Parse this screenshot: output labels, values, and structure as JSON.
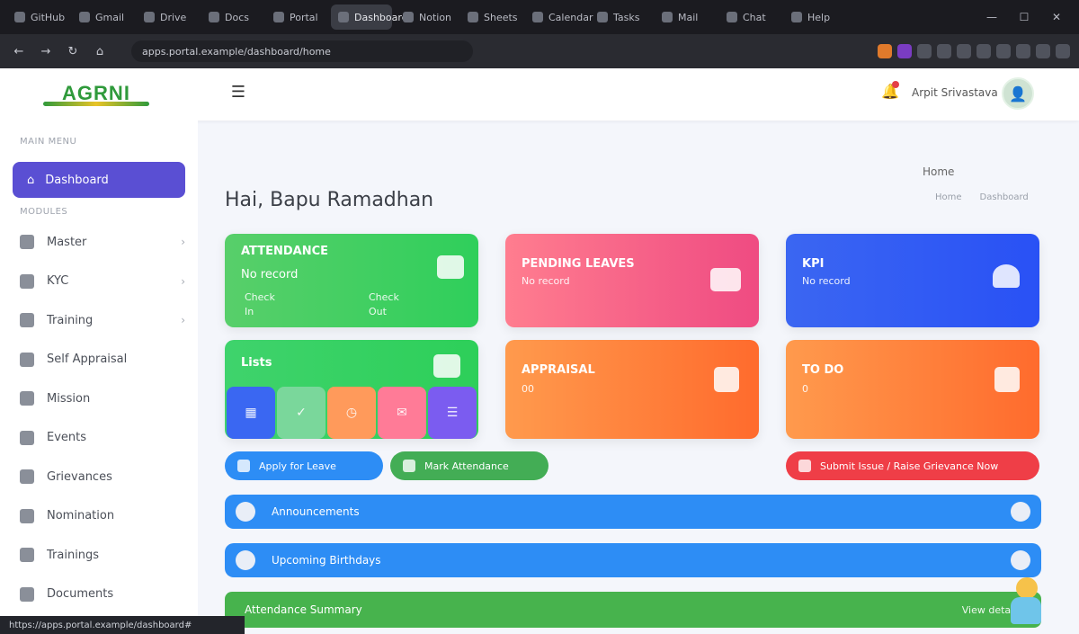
{
  "browser": {
    "tabs": [
      {
        "label": "GitHub",
        "active": false
      },
      {
        "label": "Gmail",
        "active": false
      },
      {
        "label": "Drive",
        "active": false
      },
      {
        "label": "Docs",
        "active": false
      },
      {
        "label": "Portal",
        "active": false
      },
      {
        "label": "Dashboard",
        "active": true
      },
      {
        "label": "Notion",
        "active": false
      },
      {
        "label": "Sheets",
        "active": false
      },
      {
        "label": "Calendar",
        "active": false
      },
      {
        "label": "Tasks",
        "active": false
      },
      {
        "label": "Mail",
        "active": false
      },
      {
        "label": "Chat",
        "active": false
      },
      {
        "label": "Help",
        "active": false
      }
    ],
    "address": "apps.portal.example/dashboard/home",
    "window_controls": {
      "minimize": "—",
      "maximize": "☐",
      "close": "✕"
    }
  },
  "header": {
    "logo_text": "AGRNI",
    "menu_icon": "☰",
    "user_name": "Arpit Srivastava",
    "avatar_icon": "👤",
    "bell_icon": "🔔"
  },
  "sidebar": {
    "section_main": "MAIN MENU",
    "active_item": "Dashboard",
    "section_modules": "MODULES",
    "items": [
      {
        "label": "Master",
        "chevron": "›"
      },
      {
        "label": "KYC",
        "chevron": "›"
      },
      {
        "label": "Training",
        "chevron": "›"
      },
      {
        "label": "Self Appraisal",
        "chevron": ""
      },
      {
        "label": "Mission",
        "chevron": ""
      },
      {
        "label": "Events",
        "chevron": ""
      },
      {
        "label": "Grievances",
        "chevron": ""
      },
      {
        "label": "Nomination",
        "chevron": ""
      },
      {
        "label": "Trainings",
        "chevron": ""
      },
      {
        "label": "Documents",
        "chevron": ""
      }
    ]
  },
  "page": {
    "breadcrumb_label": "Home",
    "breadcrumb": [
      "Home",
      "Dashboard"
    ],
    "title": "Hai, Bapu Ramadhan"
  },
  "cards": {
    "attendance": {
      "title": "ATTENDANCE",
      "subtitle": "No record",
      "col1_label": "Check",
      "col1_value": "In",
      "col2_label": "Check",
      "col2_value": "Out"
    },
    "pink": {
      "title": "PENDING LEAVES",
      "value": "No record"
    },
    "blue": {
      "title": "KPI",
      "value": "No record"
    },
    "lists": {
      "title": "Lists"
    },
    "orange1": {
      "title": "APPRAISAL",
      "value": "00"
    },
    "orange2": {
      "title": "TO DO",
      "value": "0"
    }
  },
  "mini_tiles": [
    {
      "icon": "▦",
      "color": "#3a67f2"
    },
    {
      "icon": "✓",
      "color": "#7ad79b"
    },
    {
      "icon": "◷",
      "color": "#ff9a5b"
    },
    {
      "icon": "✉",
      "color": "#ff7b97"
    },
    {
      "icon": "☰",
      "color": "#7b5cf0"
    }
  ],
  "pills": {
    "blue": "Apply for Leave",
    "green": "Mark Attendance",
    "red": "Submit Issue / Raise Grievance Now"
  },
  "strips": [
    {
      "label": "Announcements"
    },
    {
      "label": "Upcoming Birthdays"
    }
  ],
  "green_bar": {
    "left": "Attendance Summary",
    "right": "View details"
  },
  "statusbar": {
    "text": "https://apps.portal.example/dashboard#"
  }
}
